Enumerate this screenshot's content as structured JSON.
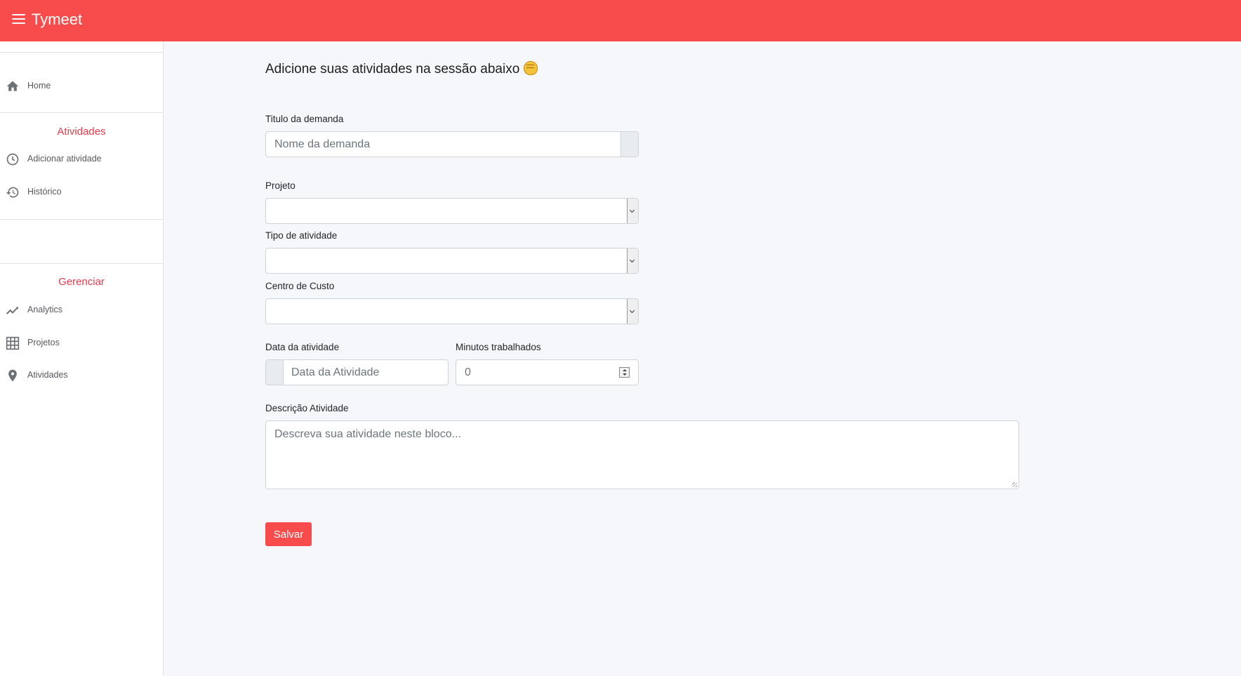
{
  "app": {
    "title": "Tymeet"
  },
  "sidebar": {
    "home_label": "Home",
    "sections": [
      {
        "title": "Atividades",
        "items": [
          {
            "label": "Adicionar atividade",
            "icon": "clock-icon"
          },
          {
            "label": "Histórico",
            "icon": "history-icon"
          }
        ]
      },
      {
        "title": "Gerenciar",
        "items": [
          {
            "label": "Analytics",
            "icon": "trend-line-icon"
          },
          {
            "label": "Projetos",
            "icon": "grid-icon"
          },
          {
            "label": "Atividades",
            "icon": "map-pin-icon"
          }
        ]
      }
    ]
  },
  "form": {
    "heading": "Adicione suas atividades na sessão abaixo",
    "titulo_label": "Titulo da demanda",
    "titulo_placeholder": "Nome da demanda",
    "projeto_label": "Projeto",
    "projeto_value": "",
    "tipo_label": "Tipo de atividade",
    "tipo_value": "",
    "centro_label": "Centro de Custo",
    "centro_value": "",
    "data_label": "Data da atividade",
    "data_placeholder": "Data da Atividade",
    "minutos_label": "Minutos trabalhados",
    "minutos_value": "0",
    "descricao_label": "Descrição Atividade",
    "descricao_placeholder": "Descreva sua atividade neste bloco...",
    "save_label": "Salvar"
  },
  "colors": {
    "brand": "#f84b4b",
    "section_title": "#f0394a",
    "sidebar_text": "#555a60"
  }
}
